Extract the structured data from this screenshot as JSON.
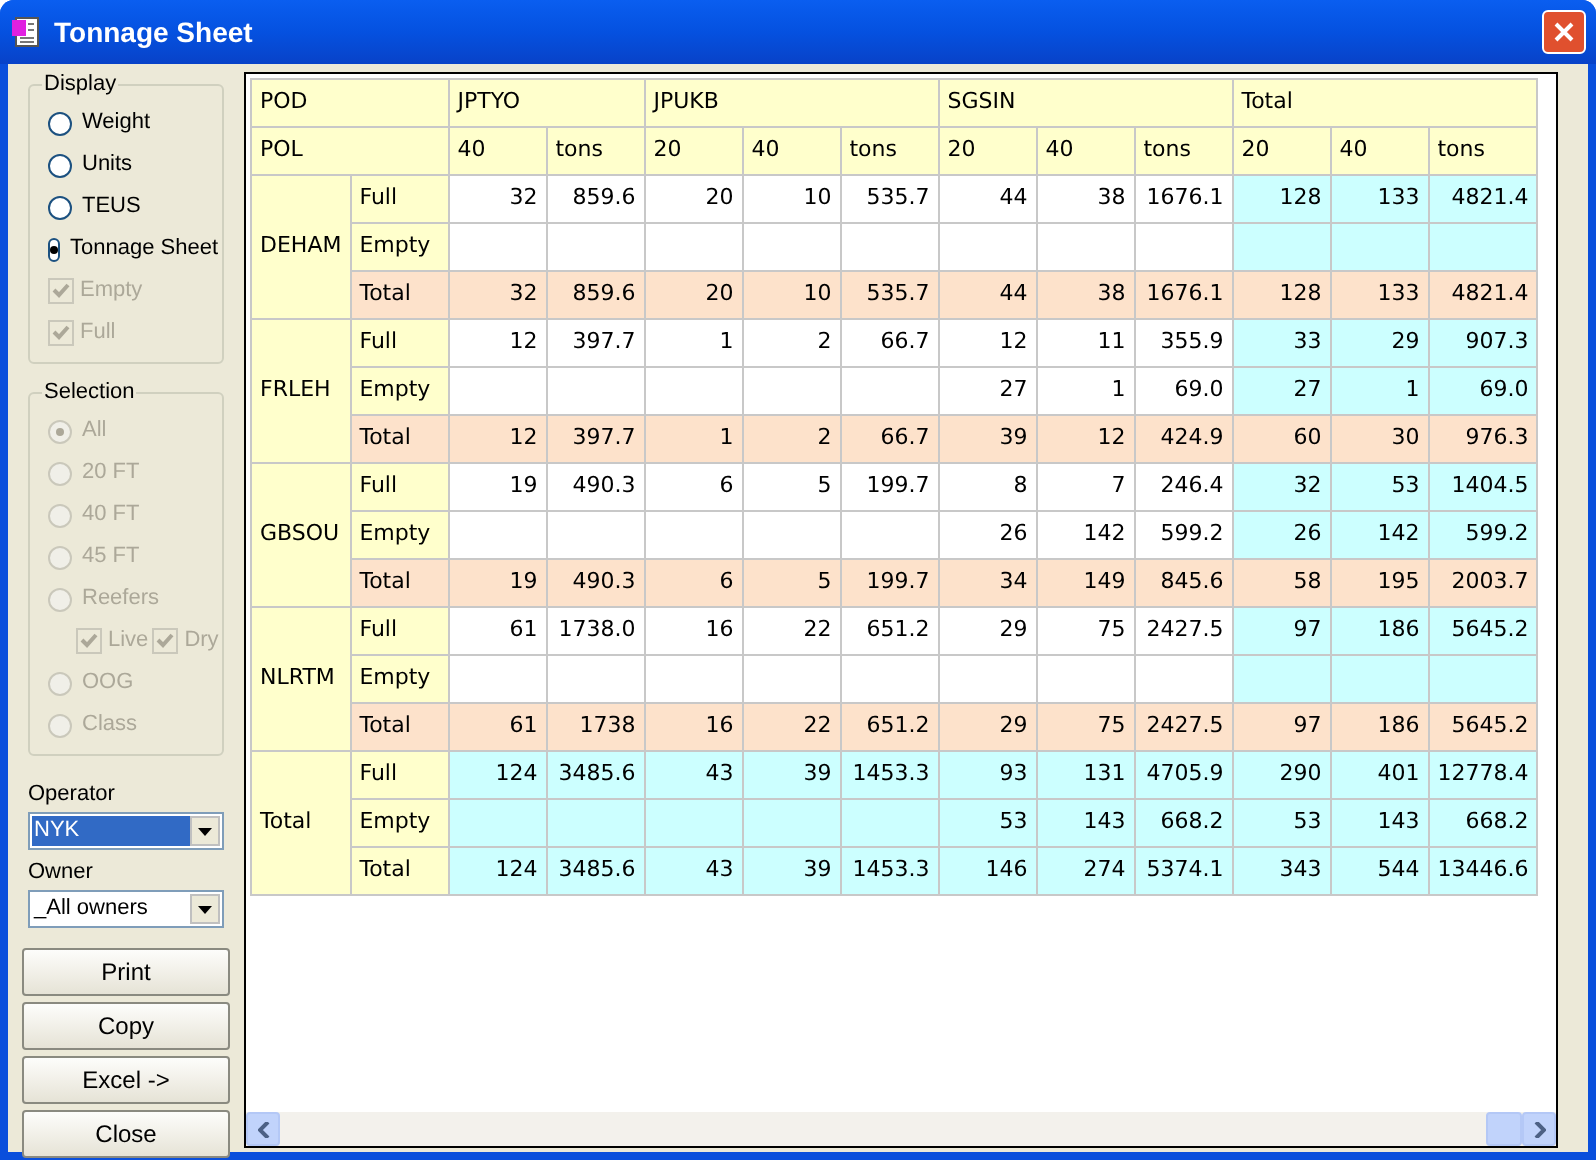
{
  "window": {
    "title": "Tonnage Sheet"
  },
  "display": {
    "title": "Display",
    "options": [
      {
        "kind": "radio",
        "label": "Weight",
        "selected": false,
        "disabled": false
      },
      {
        "kind": "radio",
        "label": "Units",
        "selected": false,
        "disabled": false
      },
      {
        "kind": "radio",
        "label": "TEUS",
        "selected": false,
        "disabled": false
      },
      {
        "kind": "radio",
        "label": "Tonnage Sheet",
        "selected": true,
        "disabled": false
      },
      {
        "kind": "checkbox",
        "label": "Empty",
        "checked": true,
        "disabled": true
      },
      {
        "kind": "checkbox",
        "label": "Full",
        "checked": true,
        "disabled": true
      }
    ]
  },
  "selection": {
    "title": "Selection",
    "options": [
      {
        "kind": "radio",
        "label": "All",
        "selected": true,
        "disabled": true
      },
      {
        "kind": "radio",
        "label": "20 FT",
        "selected": false,
        "disabled": true
      },
      {
        "kind": "radio",
        "label": "40 FT",
        "selected": false,
        "disabled": true
      },
      {
        "kind": "radio",
        "label": "45 FT",
        "selected": false,
        "disabled": true
      },
      {
        "kind": "radio",
        "label": "Reefers",
        "selected": false,
        "disabled": true,
        "children": [
          {
            "label": "Live",
            "checked": true,
            "disabled": true
          },
          {
            "label": "Dry",
            "checked": true,
            "disabled": true
          }
        ]
      },
      {
        "kind": "radio",
        "label": "OOG",
        "selected": false,
        "disabled": true
      },
      {
        "kind": "radio",
        "label": "Class",
        "selected": false,
        "disabled": true
      }
    ]
  },
  "operator": {
    "label": "Operator",
    "value": "NYK"
  },
  "owner": {
    "label": "Owner",
    "value": "_All owners"
  },
  "buttons": [
    "Print",
    "Copy",
    "Excel ->",
    "Close"
  ],
  "table": {
    "pod_label": "POD",
    "pol_label": "POL",
    "destinations": [
      {
        "name": "JPTYO",
        "kind": "port",
        "columns": [
          "40",
          "tons"
        ]
      },
      {
        "name": "JPUKB",
        "kind": "port",
        "columns": [
          "20",
          "40",
          "tons"
        ]
      },
      {
        "name": "SGSIN",
        "kind": "port",
        "columns": [
          "20",
          "40",
          "tons"
        ]
      },
      {
        "name": "Total",
        "kind": "total",
        "columns": [
          "20",
          "40",
          "tons"
        ]
      }
    ],
    "groups": [
      {
        "port": "DEHAM",
        "kind": "port",
        "rows": [
          {
            "type": "Full",
            "kind": "detail",
            "cells": [
              "32",
              "859.6",
              "20",
              "10",
              "535.7",
              "44",
              "38",
              "1676.1",
              "128",
              "133",
              "4821.4"
            ]
          },
          {
            "type": "Empty",
            "kind": "detail",
            "cells": [
              null,
              null,
              null,
              null,
              null,
              null,
              null,
              null,
              null,
              null,
              null
            ]
          },
          {
            "type": "Total",
            "kind": "total",
            "cells": [
              "32",
              "859.6",
              "20",
              "10",
              "535.7",
              "44",
              "38",
              "1676.1",
              "128",
              "133",
              "4821.4"
            ]
          }
        ]
      },
      {
        "port": "FRLEH",
        "kind": "port",
        "rows": [
          {
            "type": "Full",
            "kind": "detail",
            "cells": [
              "12",
              "397.7",
              "1",
              "2",
              "66.7",
              "12",
              "11",
              "355.9",
              "33",
              "29",
              "907.3"
            ]
          },
          {
            "type": "Empty",
            "kind": "detail",
            "cells": [
              null,
              null,
              null,
              null,
              null,
              "27",
              "1",
              "69.0",
              "27",
              "1",
              "69.0"
            ]
          },
          {
            "type": "Total",
            "kind": "total",
            "cells": [
              "12",
              "397.7",
              "1",
              "2",
              "66.7",
              "39",
              "12",
              "424.9",
              "60",
              "30",
              "976.3"
            ]
          }
        ]
      },
      {
        "port": "GBSOU",
        "kind": "port",
        "rows": [
          {
            "type": "Full",
            "kind": "detail",
            "cells": [
              "19",
              "490.3",
              "6",
              "5",
              "199.7",
              "8",
              "7",
              "246.4",
              "32",
              "53",
              "1404.5"
            ]
          },
          {
            "type": "Empty",
            "kind": "detail",
            "cells": [
              null,
              null,
              null,
              null,
              null,
              "26",
              "142",
              "599.2",
              "26",
              "142",
              "599.2"
            ]
          },
          {
            "type": "Total",
            "kind": "total",
            "cells": [
              "19",
              "490.3",
              "6",
              "5",
              "199.7",
              "34",
              "149",
              "845.6",
              "58",
              "195",
              "2003.7"
            ]
          }
        ]
      },
      {
        "port": "NLRTM",
        "kind": "port",
        "rows": [
          {
            "type": "Full",
            "kind": "detail",
            "cells": [
              "61",
              "1738.0",
              "16",
              "22",
              "651.2",
              "29",
              "75",
              "2427.5",
              "97",
              "186",
              "5645.2"
            ]
          },
          {
            "type": "Empty",
            "kind": "detail",
            "cells": [
              null,
              null,
              null,
              null,
              null,
              null,
              null,
              null,
              null,
              null,
              null
            ]
          },
          {
            "type": "Total",
            "kind": "total",
            "cells": [
              "61",
              "1738",
              "16",
              "22",
              "651.2",
              "29",
              "75",
              "2427.5",
              "97",
              "186",
              "5645.2"
            ]
          }
        ]
      },
      {
        "port": "Total",
        "kind": "total",
        "rows": [
          {
            "type": "Full",
            "cells": [
              "124",
              "3485.6",
              "43",
              "39",
              "1453.3",
              "93",
              "131",
              "4705.9",
              "290",
              "401",
              "12778.4"
            ]
          },
          {
            "type": "Empty",
            "cells": [
              null,
              null,
              null,
              null,
              null,
              "53",
              "143",
              "668.2",
              "53",
              "143",
              "668.2"
            ]
          },
          {
            "type": "Total",
            "cells": [
              "124",
              "3485.6",
              "43",
              "39",
              "1453.3",
              "146",
              "274",
              "5374.1",
              "343",
              "544",
              "13446.6"
            ]
          }
        ]
      }
    ]
  }
}
